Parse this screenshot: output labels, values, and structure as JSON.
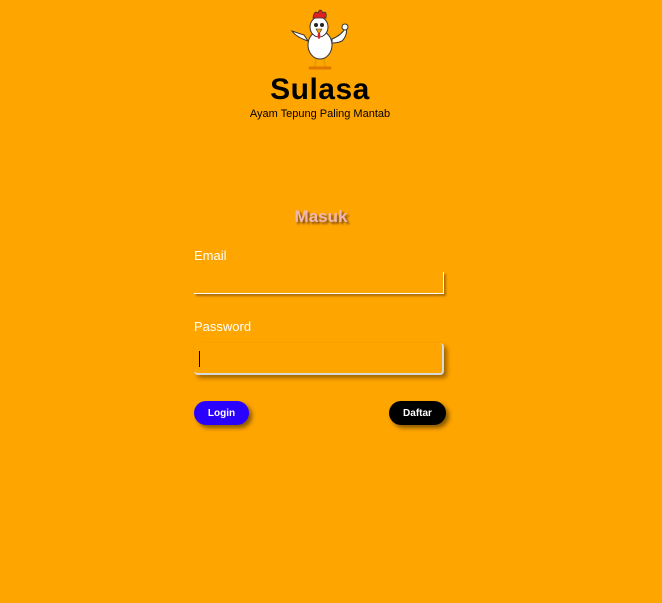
{
  "brand": {
    "name": "Sulasa",
    "tagline": "Ayam Tepung Paling Mantab",
    "logo_icon": "chicken-mascot-icon"
  },
  "form": {
    "title": "Masuk",
    "email_label": "Email",
    "email_value": "",
    "password_label": "Password",
    "password_value": "",
    "login_label": "Login",
    "register_label": "Daftar"
  },
  "colors": {
    "background": "#FFA500",
    "login_button": "#2A00FF",
    "register_button": "#000000",
    "form_title": "#F2B8B0"
  }
}
